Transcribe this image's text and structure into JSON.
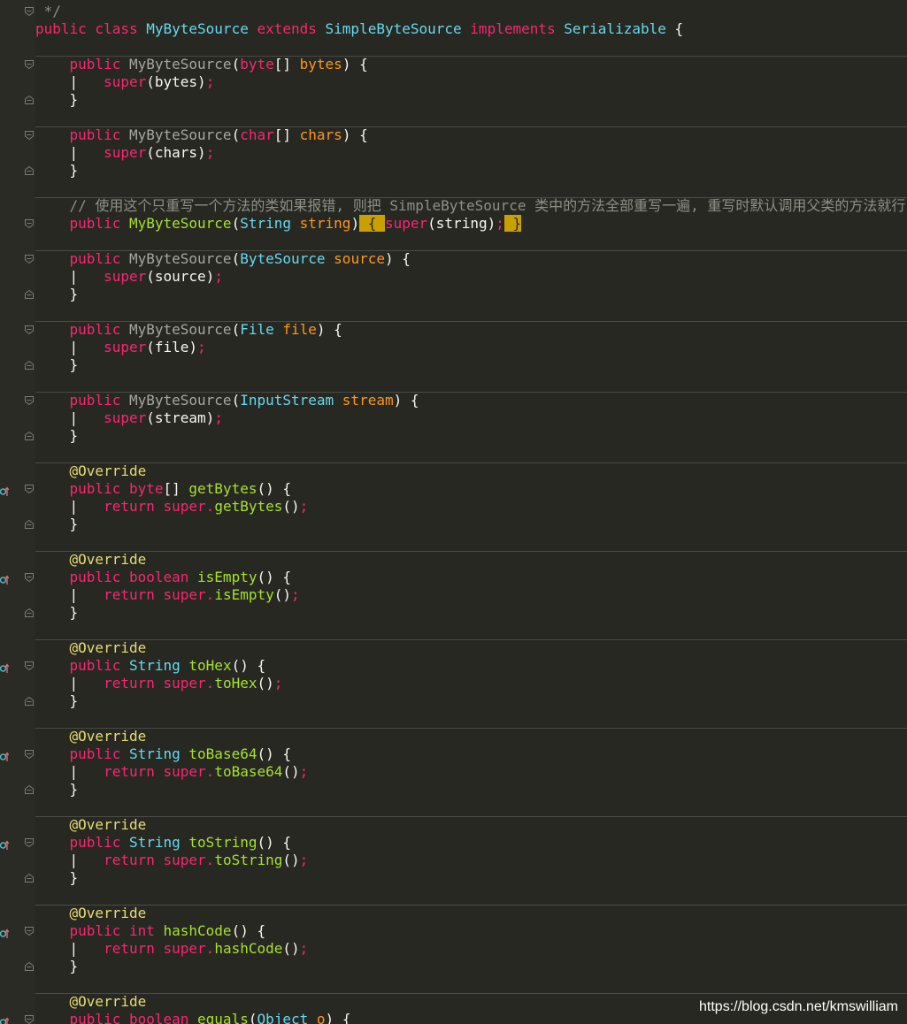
{
  "theme": {
    "background": "#272822",
    "keyword": "#f92672",
    "type": "#66d9ef",
    "function": "#a6e22e",
    "parameter": "#fd971f",
    "comment": "#8f8f86",
    "annotation": "#e6db74",
    "highlight": "#c8a000"
  },
  "code_lines": [
    [
      {
        "t": " */",
        "c": "cm"
      }
    ],
    [
      {
        "t": "public class ",
        "c": "kw"
      },
      {
        "t": "MyByteSource ",
        "c": "type"
      },
      {
        "t": "extends ",
        "c": "kw"
      },
      {
        "t": "SimpleByteSource ",
        "c": "type"
      },
      {
        "t": "implements ",
        "c": "kw"
      },
      {
        "t": "Serializable",
        "c": "type"
      },
      {
        "t": " {",
        "c": "plain"
      }
    ],
    [],
    [
      {
        "t": "    public ",
        "c": "kw"
      },
      {
        "t": "MyByteSource",
        "c": "fn2"
      },
      {
        "t": "(",
        "c": "plain"
      },
      {
        "t": "byte",
        "c": "kw"
      },
      {
        "t": "[] ",
        "c": "plain"
      },
      {
        "t": "bytes",
        "c": "param"
      },
      {
        "t": ") {",
        "c": "plain"
      }
    ],
    [
      {
        "t": "    ",
        "c": "plain"
      },
      {
        "t": "|",
        "c": "bar"
      },
      {
        "t": "   ",
        "c": "plain"
      },
      {
        "t": "super",
        "c": "kw"
      },
      {
        "t": "(bytes)",
        "c": "plain"
      },
      {
        "t": ";",
        "c": "kw"
      }
    ],
    [
      {
        "t": "    }",
        "c": "plain"
      }
    ],
    [],
    [
      {
        "t": "    public ",
        "c": "kw"
      },
      {
        "t": "MyByteSource",
        "c": "fn2"
      },
      {
        "t": "(",
        "c": "plain"
      },
      {
        "t": "char",
        "c": "kw"
      },
      {
        "t": "[] ",
        "c": "plain"
      },
      {
        "t": "chars",
        "c": "param"
      },
      {
        "t": ") {",
        "c": "plain"
      }
    ],
    [
      {
        "t": "    ",
        "c": "plain"
      },
      {
        "t": "|",
        "c": "bar"
      },
      {
        "t": "   ",
        "c": "plain"
      },
      {
        "t": "super",
        "c": "kw"
      },
      {
        "t": "(chars)",
        "c": "plain"
      },
      {
        "t": ";",
        "c": "kw"
      }
    ],
    [
      {
        "t": "    }",
        "c": "plain"
      }
    ],
    [],
    [
      {
        "t": "    // 使用这个只重写一个方法的类如果报错, 则把 SimpleByteSource 类中的方法全部重写一遍, 重写时默认调用父类的方法就行",
        "c": "cm"
      }
    ],
    [
      {
        "t": "    public ",
        "c": "kw"
      },
      {
        "t": "MyByteSource",
        "c": "fn"
      },
      {
        "t": "(",
        "c": "plain"
      },
      {
        "t": "String ",
        "c": "type"
      },
      {
        "t": "string",
        "c": "param"
      },
      {
        "t": ")",
        "c": "plain"
      },
      {
        "t": " { ",
        "c": "hl"
      },
      {
        "t": "super",
        "c": "kw"
      },
      {
        "t": "(string)",
        "c": "plain"
      },
      {
        "t": ";",
        "c": "kw"
      },
      {
        "t": " }",
        "c": "hl"
      }
    ],
    [],
    [
      {
        "t": "    public ",
        "c": "kw"
      },
      {
        "t": "MyByteSource",
        "c": "fn2"
      },
      {
        "t": "(",
        "c": "plain"
      },
      {
        "t": "ByteSource ",
        "c": "type"
      },
      {
        "t": "source",
        "c": "param"
      },
      {
        "t": ") {",
        "c": "plain"
      }
    ],
    [
      {
        "t": "    ",
        "c": "plain"
      },
      {
        "t": "|",
        "c": "bar"
      },
      {
        "t": "   ",
        "c": "plain"
      },
      {
        "t": "super",
        "c": "kw"
      },
      {
        "t": "(source)",
        "c": "plain"
      },
      {
        "t": ";",
        "c": "kw"
      }
    ],
    [
      {
        "t": "    }",
        "c": "plain"
      }
    ],
    [],
    [
      {
        "t": "    public ",
        "c": "kw"
      },
      {
        "t": "MyByteSource",
        "c": "fn2"
      },
      {
        "t": "(",
        "c": "plain"
      },
      {
        "t": "File ",
        "c": "type"
      },
      {
        "t": "file",
        "c": "param"
      },
      {
        "t": ") {",
        "c": "plain"
      }
    ],
    [
      {
        "t": "    ",
        "c": "plain"
      },
      {
        "t": "|",
        "c": "bar"
      },
      {
        "t": "   ",
        "c": "plain"
      },
      {
        "t": "super",
        "c": "kw"
      },
      {
        "t": "(file)",
        "c": "plain"
      },
      {
        "t": ";",
        "c": "kw"
      }
    ],
    [
      {
        "t": "    }",
        "c": "plain"
      }
    ],
    [],
    [
      {
        "t": "    public ",
        "c": "kw"
      },
      {
        "t": "MyByteSource",
        "c": "fn2"
      },
      {
        "t": "(",
        "c": "plain"
      },
      {
        "t": "InputStream ",
        "c": "type"
      },
      {
        "t": "stream",
        "c": "param"
      },
      {
        "t": ") {",
        "c": "plain"
      }
    ],
    [
      {
        "t": "    ",
        "c": "plain"
      },
      {
        "t": "|",
        "c": "bar"
      },
      {
        "t": "   ",
        "c": "plain"
      },
      {
        "t": "super",
        "c": "kw"
      },
      {
        "t": "(stream)",
        "c": "plain"
      },
      {
        "t": ";",
        "c": "kw"
      }
    ],
    [
      {
        "t": "    }",
        "c": "plain"
      }
    ],
    [],
    [
      {
        "t": "    @Override",
        "c": "an"
      }
    ],
    [
      {
        "t": "    public ",
        "c": "kw"
      },
      {
        "t": "byte",
        "c": "kw"
      },
      {
        "t": "[] ",
        "c": "plain"
      },
      {
        "t": "getBytes",
        "c": "fn"
      },
      {
        "t": "() {",
        "c": "plain"
      }
    ],
    [
      {
        "t": "    ",
        "c": "plain"
      },
      {
        "t": "|",
        "c": "bar"
      },
      {
        "t": "   ",
        "c": "plain"
      },
      {
        "t": "return super.",
        "c": "kw"
      },
      {
        "t": "getBytes",
        "c": "fn"
      },
      {
        "t": "()",
        "c": "plain"
      },
      {
        "t": ";",
        "c": "kw"
      }
    ],
    [
      {
        "t": "    }",
        "c": "plain"
      }
    ],
    [],
    [
      {
        "t": "    @Override",
        "c": "an"
      }
    ],
    [
      {
        "t": "    public ",
        "c": "kw"
      },
      {
        "t": "boolean ",
        "c": "kw"
      },
      {
        "t": "isEmpty",
        "c": "fn"
      },
      {
        "t": "() {",
        "c": "plain"
      }
    ],
    [
      {
        "t": "    ",
        "c": "plain"
      },
      {
        "t": "|",
        "c": "bar"
      },
      {
        "t": "   ",
        "c": "plain"
      },
      {
        "t": "return super.",
        "c": "kw"
      },
      {
        "t": "isEmpty",
        "c": "fn"
      },
      {
        "t": "()",
        "c": "plain"
      },
      {
        "t": ";",
        "c": "kw"
      }
    ],
    [
      {
        "t": "    }",
        "c": "plain"
      }
    ],
    [],
    [
      {
        "t": "    @Override",
        "c": "an"
      }
    ],
    [
      {
        "t": "    public ",
        "c": "kw"
      },
      {
        "t": "String ",
        "c": "type"
      },
      {
        "t": "toHex",
        "c": "fn"
      },
      {
        "t": "() {",
        "c": "plain"
      }
    ],
    [
      {
        "t": "    ",
        "c": "plain"
      },
      {
        "t": "|",
        "c": "bar"
      },
      {
        "t": "   ",
        "c": "plain"
      },
      {
        "t": "return super.",
        "c": "kw"
      },
      {
        "t": "toHex",
        "c": "fn"
      },
      {
        "t": "()",
        "c": "plain"
      },
      {
        "t": ";",
        "c": "kw"
      }
    ],
    [
      {
        "t": "    }",
        "c": "plain"
      }
    ],
    [],
    [
      {
        "t": "    @Override",
        "c": "an"
      }
    ],
    [
      {
        "t": "    public ",
        "c": "kw"
      },
      {
        "t": "String ",
        "c": "type"
      },
      {
        "t": "toBase64",
        "c": "fn"
      },
      {
        "t": "() {",
        "c": "plain"
      }
    ],
    [
      {
        "t": "    ",
        "c": "plain"
      },
      {
        "t": "|",
        "c": "bar"
      },
      {
        "t": "   ",
        "c": "plain"
      },
      {
        "t": "return super.",
        "c": "kw"
      },
      {
        "t": "toBase64",
        "c": "fn"
      },
      {
        "t": "()",
        "c": "plain"
      },
      {
        "t": ";",
        "c": "kw"
      }
    ],
    [
      {
        "t": "    }",
        "c": "plain"
      }
    ],
    [],
    [
      {
        "t": "    @Override",
        "c": "an"
      }
    ],
    [
      {
        "t": "    public ",
        "c": "kw"
      },
      {
        "t": "String ",
        "c": "type"
      },
      {
        "t": "toString",
        "c": "fn"
      },
      {
        "t": "() {",
        "c": "plain"
      }
    ],
    [
      {
        "t": "    ",
        "c": "plain"
      },
      {
        "t": "|",
        "c": "bar"
      },
      {
        "t": "   ",
        "c": "plain"
      },
      {
        "t": "return super.",
        "c": "kw"
      },
      {
        "t": "toString",
        "c": "fn"
      },
      {
        "t": "()",
        "c": "plain"
      },
      {
        "t": ";",
        "c": "kw"
      }
    ],
    [
      {
        "t": "    }",
        "c": "plain"
      }
    ],
    [],
    [
      {
        "t": "    @Override",
        "c": "an"
      }
    ],
    [
      {
        "t": "    public ",
        "c": "kw"
      },
      {
        "t": "int ",
        "c": "kw"
      },
      {
        "t": "hashCode",
        "c": "fn"
      },
      {
        "t": "() {",
        "c": "plain"
      }
    ],
    [
      {
        "t": "    ",
        "c": "plain"
      },
      {
        "t": "|",
        "c": "bar"
      },
      {
        "t": "   ",
        "c": "plain"
      },
      {
        "t": "return super.",
        "c": "kw"
      },
      {
        "t": "hashCode",
        "c": "fn"
      },
      {
        "t": "()",
        "c": "plain"
      },
      {
        "t": ";",
        "c": "kw"
      }
    ],
    [
      {
        "t": "    }",
        "c": "plain"
      }
    ],
    [],
    [
      {
        "t": "    @Override",
        "c": "an"
      }
    ],
    [
      {
        "t": "    public ",
        "c": "kw"
      },
      {
        "t": "boolean ",
        "c": "kw"
      },
      {
        "t": "equals",
        "c": "fn"
      },
      {
        "t": "(",
        "c": "plain"
      },
      {
        "t": "Object ",
        "c": "type"
      },
      {
        "t": "o",
        "c": "param"
      },
      {
        "t": ") {",
        "c": "plain"
      }
    ]
  ],
  "separators_after_lines": [
    2,
    6,
    10,
    13,
    17,
    21,
    25,
    30,
    35,
    40,
    45,
    50,
    55
  ],
  "fold_lines": {
    "start": [
      0,
      3,
      7,
      12,
      14,
      18,
      22,
      27,
      32,
      37,
      42,
      47,
      52,
      57
    ],
    "end": [
      5,
      9,
      16,
      20,
      24,
      29,
      34,
      39,
      44,
      49,
      54
    ]
  },
  "implementation_marker_lines": [
    27,
    32,
    37,
    42,
    47,
    52,
    57
  ],
  "icons": {
    "fold": "fold-marker-icon",
    "implements": "override-marker-icon"
  },
  "watermark": {
    "text": "https://blog.csdn.net/kmswilliam"
  }
}
